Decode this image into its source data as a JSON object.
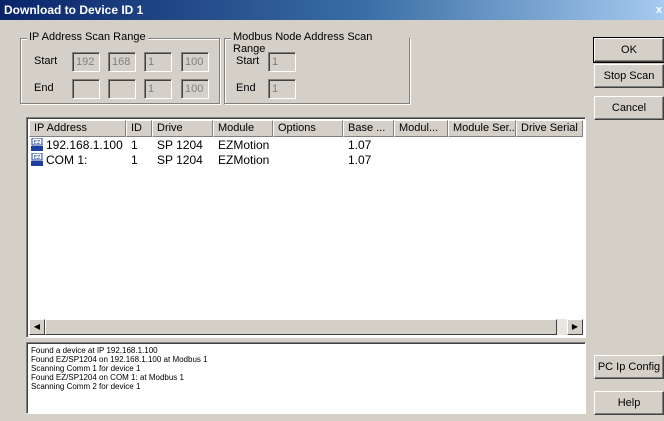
{
  "window": {
    "title": "Download to Device ID 1",
    "close_glyph": "x"
  },
  "ip_group": {
    "legend": "IP Address Scan Range",
    "start_label": "Start",
    "end_label": "End",
    "start_octets": [
      "192",
      "168",
      "1",
      "100"
    ],
    "end_octets": [
      "",
      "",
      "1",
      "100"
    ]
  },
  "modbus_group": {
    "legend": "Modbus Node Address Scan Range",
    "start_label": "Start",
    "end_label": "End",
    "start_value": "1",
    "end_value": "1"
  },
  "buttons": {
    "ok": "OK",
    "stop_scan": "Stop Scan",
    "cancel": "Cancel",
    "pc_ip_config": "PC Ip Config",
    "help": "Help"
  },
  "device_list": {
    "columns": [
      "IP Address",
      "ID",
      "Drive",
      "Module",
      "Options",
      "Base ...",
      "Modul...",
      "Module Ser...",
      "Drive Serial"
    ],
    "rows": [
      {
        "icon": "ez-device-icon",
        "ip": "192.168.1.100",
        "id": "1",
        "drive": "SP 1204",
        "module": "EZMotion",
        "options": "",
        "base": "1.07",
        "modul": "",
        "module_serial": "",
        "drive_serial": ""
      },
      {
        "icon": "ez-device-icon",
        "ip": "COM 1:",
        "id": "1",
        "drive": "SP 1204",
        "module": "EZMotion",
        "options": "",
        "base": "1.07",
        "modul": "",
        "module_serial": "",
        "drive_serial": ""
      }
    ]
  },
  "log": [
    "Found a device at IP 192.168.1.100",
    "Found EZ/SP1204 on 192.168.1.100 at Modbus 1",
    "Scanning Comm 1 for device 1",
    "Found EZ/SP1204 on COM 1: at Modbus 1",
    "Scanning Comm 2 for device 1"
  ],
  "icons": {
    "scroll_left": "◀",
    "scroll_right": "▶"
  }
}
